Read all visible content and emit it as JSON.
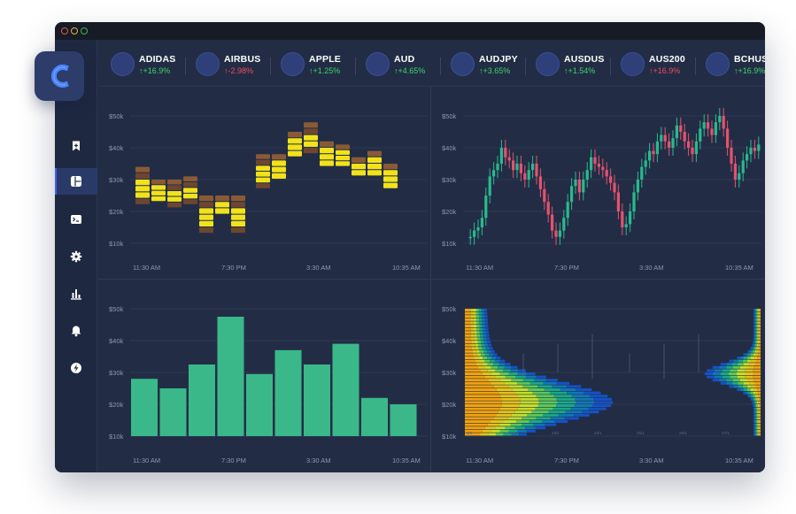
{
  "colors": {
    "window_bg": "#222d45",
    "titlebar_bg": "#161b25",
    "sidebar_bg": "#1f2841",
    "sidebar_active": "#2a3a68",
    "accent_blue": "#3c63e8",
    "positive": "#3ed36a",
    "negative": "#f04a5f",
    "bar_green": "#3bb88a",
    "candle_up": "#2ab98f",
    "candle_down": "#e5526f"
  },
  "logo": {
    "icon": "c-letter-logo-icon"
  },
  "sidebar": {
    "items": [
      {
        "name": "bookmark-add",
        "icon": "bookmark-plus-icon",
        "active": false
      },
      {
        "name": "dashboard",
        "icon": "dashboard-layout-icon",
        "active": true
      },
      {
        "name": "terminal",
        "icon": "terminal-icon",
        "active": false
      },
      {
        "name": "settings",
        "icon": "gear-icon",
        "active": false
      },
      {
        "name": "analytics",
        "icon": "bar-chart-icon",
        "active": false
      },
      {
        "name": "notifications",
        "icon": "bell-icon",
        "active": false
      },
      {
        "name": "power",
        "icon": "lightning-icon",
        "active": false
      }
    ]
  },
  "tickers": [
    {
      "symbol": "ADIDAS",
      "change": "+16.9%",
      "direction": "up",
      "arrow": "↑"
    },
    {
      "symbol": "AIRBUS",
      "change": "-2.98%",
      "direction": "down",
      "arrow": "↑"
    },
    {
      "symbol": "APPLE",
      "change": "+1.25%",
      "direction": "up",
      "arrow": "↑"
    },
    {
      "symbol": "AUD",
      "change": "+4.65%",
      "direction": "up",
      "arrow": "↑"
    },
    {
      "symbol": "AUDJPY",
      "change": "+3.65%",
      "direction": "up",
      "arrow": "↑"
    },
    {
      "symbol": "AUSDUS",
      "change": "+1.54%",
      "direction": "up",
      "arrow": "↑"
    },
    {
      "symbol": "AUS200",
      "change": "+16.9%",
      "direction": "down",
      "arrow": "↑"
    },
    {
      "symbol": "BCHUSD",
      "change": "+16.9%",
      "direction": "up",
      "arrow": "↑"
    }
  ],
  "axes": {
    "y_labels": [
      "$50k",
      "$40k",
      "$30k",
      "$20k",
      "$10k"
    ],
    "x_labels": [
      "11:30 AM",
      "7:30 PM",
      "3:30 AM",
      "10:35 AM"
    ]
  },
  "chart_data": [
    {
      "type": "heatmap",
      "panel": "footprint",
      "x_ticks": [
        "11:30 AM",
        "7:30 PM",
        "3:30 AM",
        "10:35 AM"
      ],
      "y_ticks": [
        "$50k",
        "$40k",
        "$30k",
        "$20k",
        "$10k"
      ],
      "ylim": [
        10000,
        50000
      ],
      "columns": [
        {
          "low": 22000,
          "high": 34000
        },
        {
          "low": 23000,
          "high": 30000
        },
        {
          "low": 21000,
          "high": 30000
        },
        {
          "low": 22000,
          "high": 31000
        },
        {
          "low": 13000,
          "high": 25000
        },
        {
          "low": 19000,
          "high": 25000
        },
        {
          "low": 13000,
          "high": 25000
        },
        {
          "low": 27000,
          "high": 38000
        },
        {
          "low": 30000,
          "high": 38000
        },
        {
          "low": 37000,
          "high": 45000
        },
        {
          "low": 38000,
          "high": 48000
        },
        {
          "low": 34000,
          "high": 42000
        },
        {
          "low": 34000,
          "high": 41000
        },
        {
          "low": 31000,
          "high": 37000
        },
        {
          "low": 31000,
          "high": 39000
        },
        {
          "low": 27000,
          "high": 35000
        }
      ]
    },
    {
      "type": "candlestick",
      "panel": "price",
      "x_ticks": [
        "11:30 AM",
        "7:30 PM",
        "3:30 AM",
        "10:35 AM"
      ],
      "y_ticks": [
        "$50k",
        "$40k",
        "$30k",
        "$20k",
        "$10k"
      ],
      "ylim": [
        10000,
        50000
      ],
      "close": [
        12000,
        14000,
        15000,
        18000,
        25000,
        31000,
        33000,
        35000,
        40000,
        37000,
        36000,
        33000,
        35000,
        32000,
        30000,
        33000,
        35000,
        31000,
        27000,
        23000,
        19000,
        14000,
        12000,
        14000,
        18000,
        23000,
        28000,
        30000,
        26000,
        30000,
        33000,
        37000,
        35000,
        34000,
        33000,
        31000,
        29000,
        26000,
        20000,
        15000,
        16000,
        20000,
        26000,
        30000,
        34000,
        36000,
        39000,
        38000,
        42000,
        44000,
        42000,
        40000,
        43000,
        47000,
        45000,
        42000,
        40000,
        38000,
        42000,
        46000,
        48000,
        46000,
        44000,
        48000,
        50000,
        46000,
        40000,
        35000,
        30000,
        32000,
        36000,
        38000,
        40000,
        39000,
        41000
      ]
    },
    {
      "type": "bar",
      "panel": "volume",
      "x_ticks": [
        "11:30 AM",
        "7:30 PM",
        "3:30 AM",
        "10:35 AM"
      ],
      "y_ticks": [
        "$50k",
        "$40k",
        "$30k",
        "$20k",
        "$10k"
      ],
      "ylim": [
        10000,
        50000
      ],
      "values": [
        28000,
        25000,
        32500,
        47500,
        29500,
        37000,
        32500,
        39000,
        22000,
        20000
      ]
    },
    {
      "type": "heatmap",
      "panel": "volume-profile",
      "x_ticks": [
        "11:30 AM",
        "7:30 PM",
        "3:30 AM",
        "10:35 AM"
      ],
      "y_ticks": [
        "$50k",
        "$40k",
        "$30k",
        "$20k",
        "$10k"
      ],
      "ylim": [
        10000,
        50000
      ],
      "inner_axis": [
        "0/0",
        "20/1",
        "23/1",
        "24/1",
        "25/1",
        "26/1",
        "27/1"
      ]
    }
  ]
}
